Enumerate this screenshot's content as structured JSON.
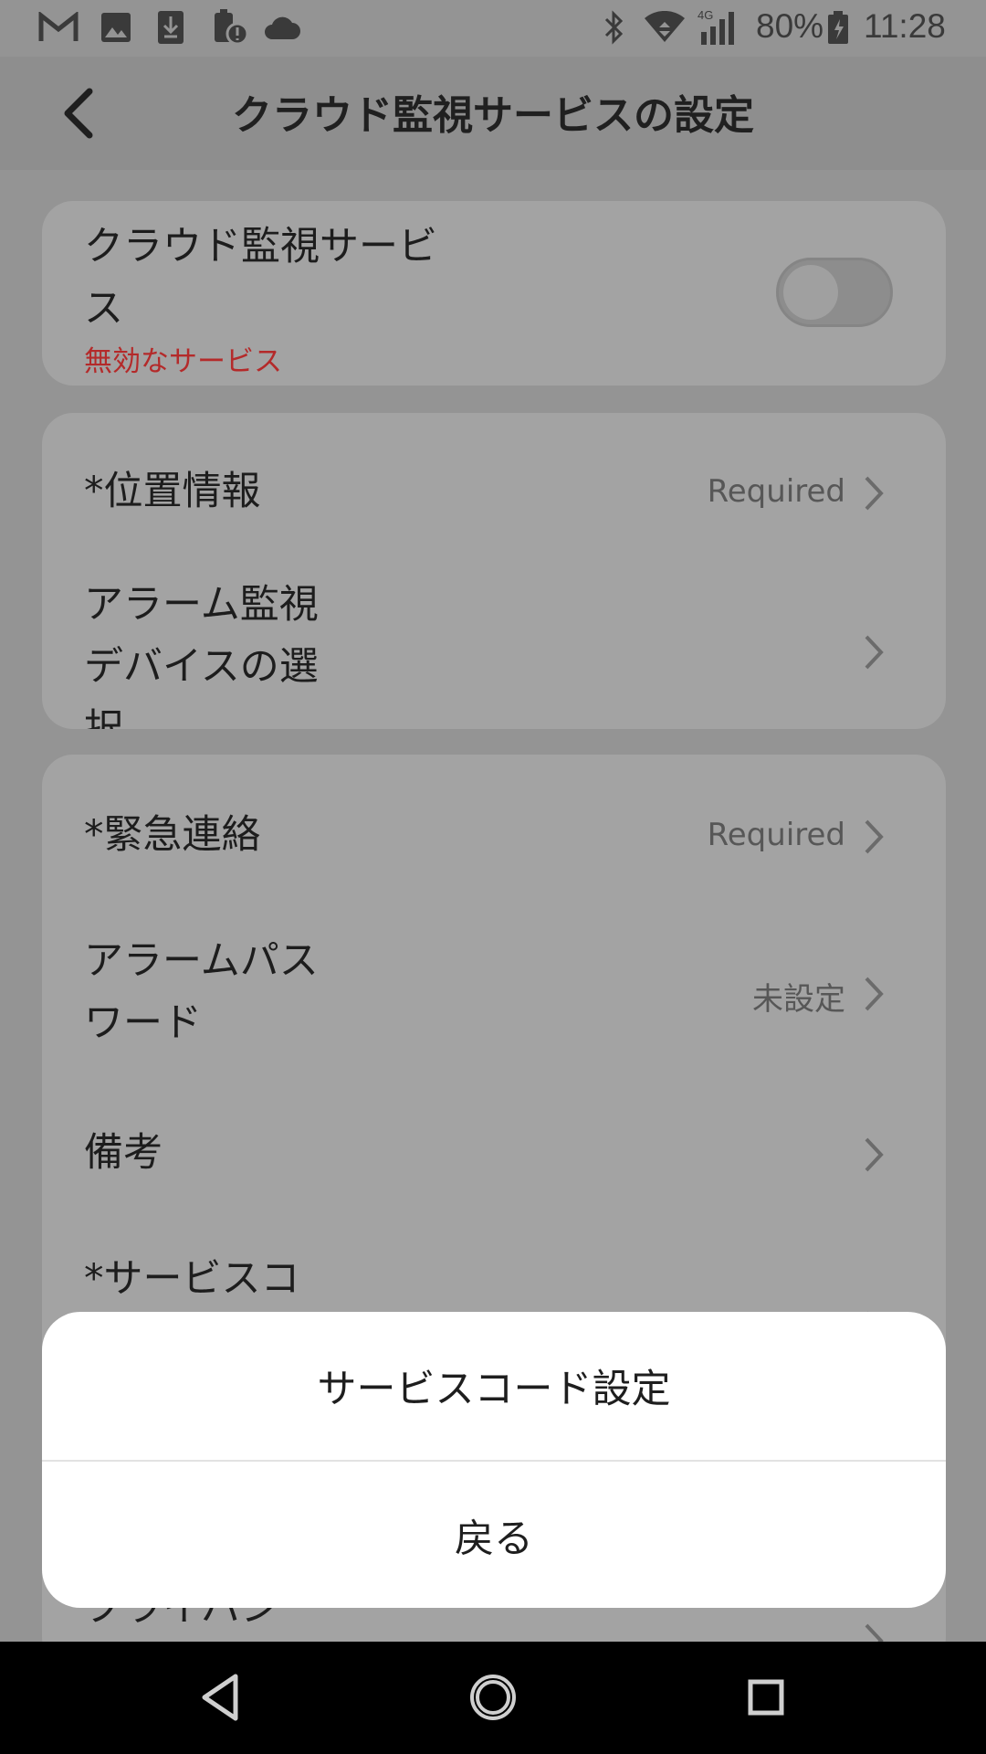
{
  "status_bar": {
    "battery": "80%",
    "time": "11:28",
    "network": "4G",
    "icons": [
      "gmail-icon",
      "image-icon",
      "download-icon",
      "battery-alert-icon",
      "cloud-icon",
      "bluetooth-icon",
      "wifi-icon",
      "signal-icon",
      "battery-icon"
    ]
  },
  "header": {
    "title": "クラウド監視サービスの設定",
    "back_icon": "chevron-left-icon"
  },
  "service_card": {
    "label_line1": "クラウド監視サービ",
    "label_line2": "ス",
    "status": "無効なサービス",
    "toggle_on": false
  },
  "card2": {
    "rows": [
      {
        "label": "*位置情報",
        "value": "Required"
      },
      {
        "label_lines": [
          "アラーム監視",
          "デバイスの選",
          "択"
        ],
        "value": ""
      }
    ]
  },
  "card3": {
    "rows": [
      {
        "label": "*緊急連絡",
        "value": "Required"
      },
      {
        "label_lines": [
          "アラームパス",
          "ワード"
        ],
        "value": "未設定"
      },
      {
        "label": "備考",
        "value": ""
      },
      {
        "label": "*サービスコ",
        "value": ""
      },
      {
        "label": "プライバシー",
        "value": ""
      }
    ]
  },
  "bottom_sheet": {
    "option": "サービスコード設定",
    "cancel": "戻る"
  },
  "colors": {
    "status_red": "#b42a2a",
    "sheet_bg": "#ffffff",
    "scrim_bg": "#949494"
  }
}
